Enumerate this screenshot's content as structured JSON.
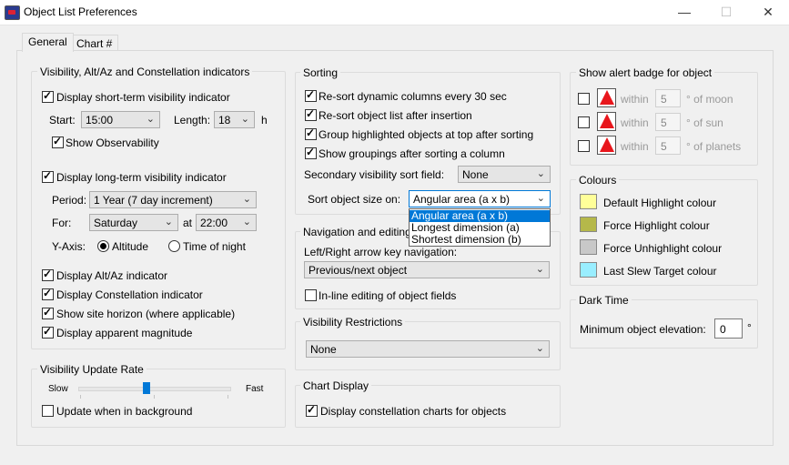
{
  "window": {
    "title": "Object List Preferences",
    "controls": {
      "minimize": "—",
      "maximize": "☐",
      "close": "✕"
    }
  },
  "tabs": [
    {
      "label": "General"
    },
    {
      "label": "Chart #"
    }
  ],
  "visibility": {
    "title": "Visibility, Alt/Az and Constellation indicators",
    "short_term": {
      "label": "Display short-term visibility indicator",
      "checked": true
    },
    "start_label": "Start:",
    "start_value": "15:00",
    "length_label": "Length:",
    "length_value": "18",
    "length_unit": "h",
    "show_observability": {
      "label": "Show Observability",
      "checked": true
    },
    "long_term": {
      "label": "Display long-term visibility indicator",
      "checked": true
    },
    "period_label": "Period:",
    "period_value": "1 Year (7 day increment)",
    "for_label": "For:",
    "for_day": "Saturday",
    "at_label": "at",
    "for_time": "22:00",
    "yaxis_label": "Y-Axis:",
    "yaxis_altitude": "Altitude",
    "yaxis_time": "Time of night",
    "yaxis_selected": "Altitude",
    "altaz": {
      "label": "Display Alt/Az indicator",
      "checked": true
    },
    "constellation": {
      "label": "Display Constellation indicator",
      "checked": true
    },
    "site_horizon": {
      "label": "Show site horizon (where applicable)",
      "checked": true
    },
    "magnitude": {
      "label": "Display apparent magnitude",
      "checked": true
    }
  },
  "update_rate": {
    "title": "Visibility Update Rate",
    "slow": "Slow",
    "fast": "Fast",
    "level": 0.45,
    "background": {
      "label": "Update when in background",
      "checked": false
    }
  },
  "sorting": {
    "title": "Sorting",
    "resort_dynamic": {
      "label": "Re-sort dynamic columns every 30 sec",
      "checked": true
    },
    "resort_insert": {
      "label": "Re-sort object list after insertion",
      "checked": true
    },
    "group_highlight": {
      "label": "Group highlighted objects at top after sorting",
      "checked": true
    },
    "show_groupings": {
      "label": "Show groupings after sorting a column",
      "checked": true
    },
    "secondary_label": "Secondary visibility sort field:",
    "secondary_value": "None",
    "size_label": "Sort object size on:",
    "size_value": "Angular area (a x b)",
    "size_options": [
      "Angular area (a x b)",
      "Longest dimension (a)",
      "Shortest dimension (b)"
    ],
    "size_selected_index": 0
  },
  "navigation": {
    "title": "Navigation and editing",
    "arrow_label": "Left/Right arrow key navigation:",
    "arrow_value": "Previous/next object",
    "inline_edit": {
      "label": "In-line editing of object fields",
      "checked": false
    }
  },
  "restrictions": {
    "title": "Visibility Restrictions",
    "value": "None"
  },
  "chart_display": {
    "title": "Chart Display",
    "constellation_charts": {
      "label": "Display constellation charts for objects",
      "checked": true
    }
  },
  "alert": {
    "title": "Show alert badge for object",
    "rows": [
      {
        "within": "within",
        "value": "5",
        "suffix": "° of moon",
        "checked": false
      },
      {
        "within": "within",
        "value": "5",
        "suffix": "° of sun",
        "checked": false
      },
      {
        "within": "within",
        "value": "5",
        "suffix": "° of planets",
        "checked": false
      }
    ]
  },
  "colours": {
    "title": "Colours",
    "items": [
      {
        "label": "Default Highlight colour",
        "color": "#ffff99"
      },
      {
        "label": "Force Highlight colour",
        "color": "#b5b84a"
      },
      {
        "label": "Force Unhighlight colour",
        "color": "#c8c8c8"
      },
      {
        "label": "Last Slew Target colour",
        "color": "#99eeff"
      }
    ]
  },
  "dark_time": {
    "title": "Dark Time",
    "min_elev_label": "Minimum object elevation:",
    "min_elev_value": "0",
    "unit": "°"
  }
}
